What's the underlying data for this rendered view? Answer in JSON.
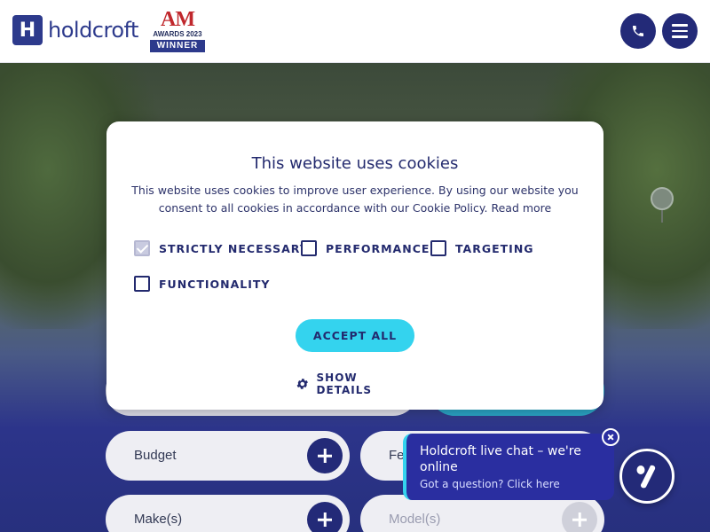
{
  "header": {
    "logo_text": "holdcroft",
    "logo_mark": "H",
    "award": {
      "title": "AM",
      "year": "AWARDS 2023",
      "badge": "WINNER"
    },
    "phone_icon": "phone-icon",
    "menu_icon": "hamburger-menu-icon"
  },
  "cookie_modal": {
    "title": "This website uses cookies",
    "text": "This website uses cookies to improve user experience. By using our website you consent to all cookies in accordance with our Cookie Policy.",
    "read_more": "Read more",
    "checkboxes": [
      {
        "label": "STRICTLY NECESSARY",
        "checked": true
      },
      {
        "label": "PERFORMANCE",
        "checked": false
      },
      {
        "label": "TARGETING",
        "checked": false
      },
      {
        "label": "FUNCTIONALITY",
        "checked": false
      }
    ],
    "accept_label": "ACCEPT ALL",
    "show_details_label": "SHOW DETAILS",
    "show_details_icon": "gear-icon"
  },
  "search_form": {
    "budget_label": "Budget",
    "fe_label": "Fe",
    "make_label": "Make(s)",
    "model_label": "Model(s)"
  },
  "live_chat": {
    "title": "Holdcroft live chat – we're online",
    "subtitle": "Got a question? Click here"
  },
  "colors": {
    "brand_navy": "#232a78",
    "accent_cyan": "#34d3ee",
    "chat_blue": "#2a2ea0"
  }
}
